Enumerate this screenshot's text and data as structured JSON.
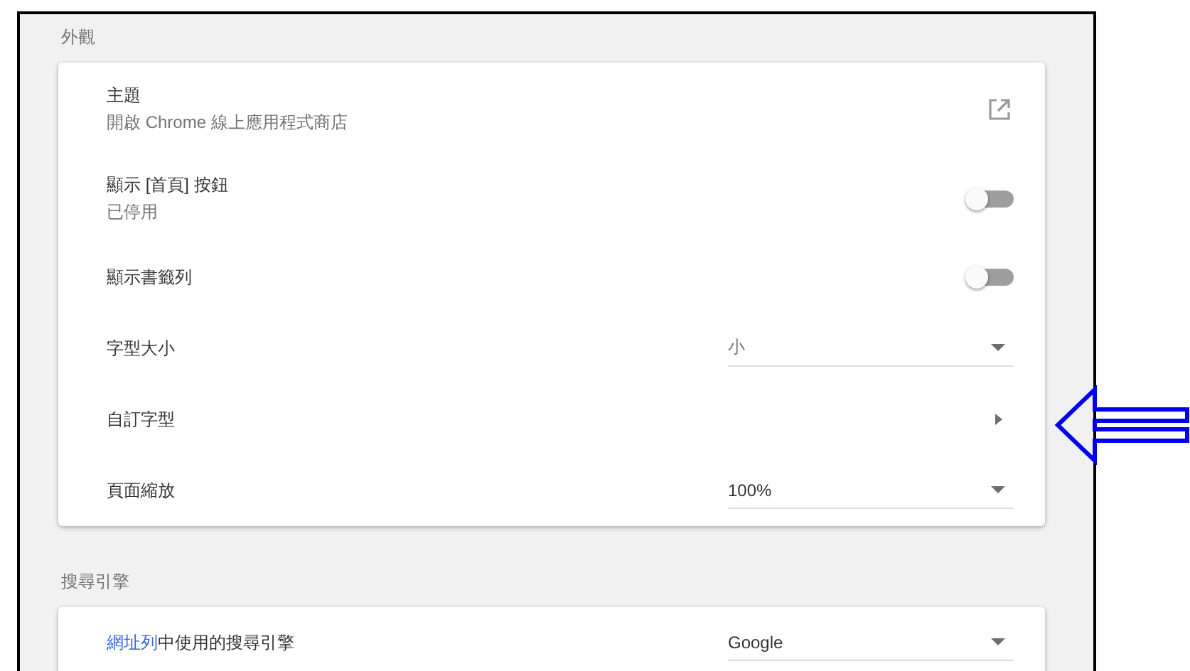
{
  "sections": [
    {
      "title": "外觀",
      "rows": [
        {
          "kind": "link",
          "label": "主題",
          "sublabel": "開啟 Chrome 線上應用程式商店"
        },
        {
          "kind": "toggle",
          "label": "顯示 [首頁] 按鈕",
          "sublabel": "已停用",
          "on": false
        },
        {
          "kind": "toggle",
          "label": "顯示書籤列",
          "on": false
        },
        {
          "kind": "select",
          "label": "字型大小",
          "value": "小"
        },
        {
          "kind": "submenu",
          "label": "自訂字型"
        },
        {
          "kind": "select",
          "label": "頁面縮放",
          "value": "100%"
        }
      ]
    },
    {
      "title": "搜尋引擎",
      "rows": [
        {
          "kind": "select",
          "link": "網址列",
          "label": "中使用的搜尋引擎",
          "value": "Google"
        }
      ]
    }
  ]
}
